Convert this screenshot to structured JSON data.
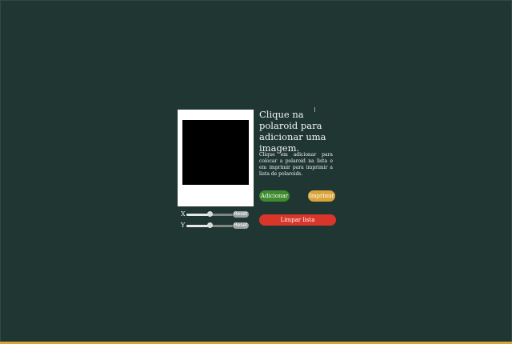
{
  "intro": {
    "heading": "Clique na polaroid para adicionar uma imagem.",
    "description": "Clique em adicionar para colocar a polaroid na lista e em imprimir para imprimir a lista de polaroids."
  },
  "actions": {
    "add_label": "Adicionar",
    "print_label": "Imprimir",
    "clear_label": "Limpar lista"
  },
  "position_controls": {
    "x": {
      "label": "X",
      "value": 0.5,
      "reset_label": "Reset"
    },
    "y": {
      "label": "Y",
      "value": 0.5,
      "reset_label": "Reset"
    }
  },
  "colors": {
    "background": "#203632",
    "add_button": "#3e8a2e",
    "print_button": "#d9a43a",
    "clear_button": "#d8362a",
    "accent_bar": "#d9a43a"
  },
  "icons": {
    "cursor": "text-cursor-icon"
  }
}
